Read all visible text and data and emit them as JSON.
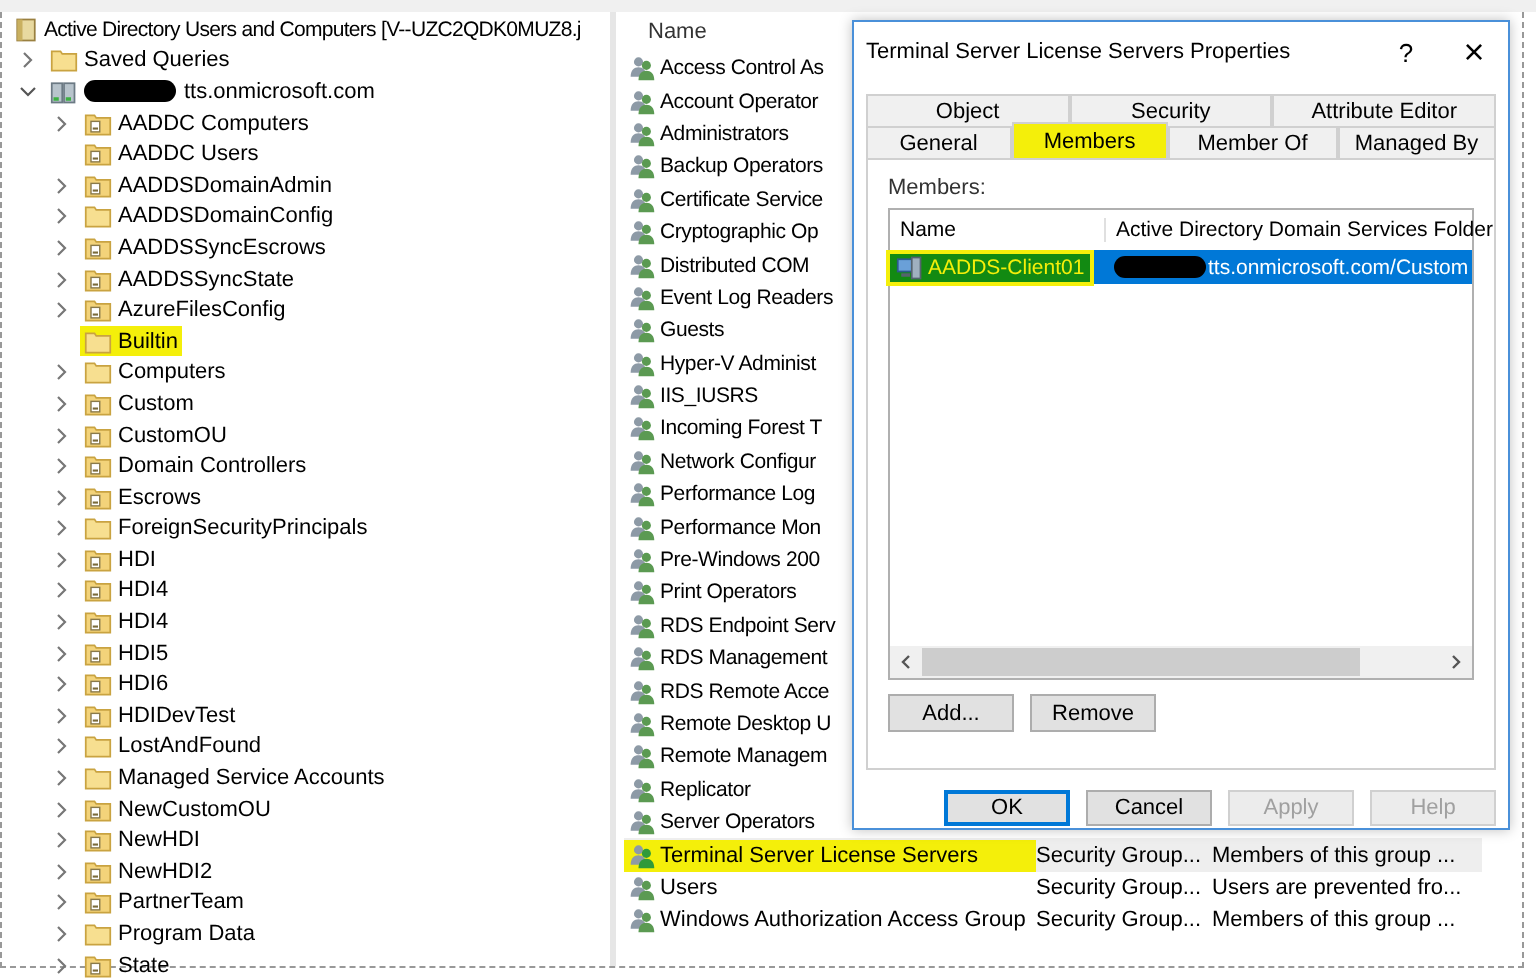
{
  "tree": {
    "root": "Active Directory Users and Computers [V--UZC2QDK0MUZ8.j",
    "items": [
      {
        "label": "Saved Queries",
        "kind": "folder",
        "has_children": true,
        "highlighted": false
      },
      {
        "label": "tts.onmicrosoft.com",
        "kind": "domain",
        "has_children": true,
        "highlighted": false,
        "children": [
          {
            "label": "AADDC Computers",
            "kind": "ou",
            "has_children": true,
            "highlighted": false
          },
          {
            "label": "AADDC Users",
            "kind": "ou",
            "has_children": false,
            "highlighted": false
          },
          {
            "label": "AADDSDomainAdmin",
            "kind": "ou",
            "has_children": true,
            "highlighted": false
          },
          {
            "label": "AADDSDomainConfig",
            "kind": "folder",
            "has_children": true,
            "highlighted": false
          },
          {
            "label": "AADDSSyncEscrows",
            "kind": "ou",
            "has_children": true,
            "highlighted": false
          },
          {
            "label": "AADDSSyncState",
            "kind": "ou",
            "has_children": true,
            "highlighted": false
          },
          {
            "label": "AzureFilesConfig",
            "kind": "ou",
            "has_children": true,
            "highlighted": false
          },
          {
            "label": "Builtin",
            "kind": "folder",
            "has_children": false,
            "highlighted": true
          },
          {
            "label": "Computers",
            "kind": "folder",
            "has_children": true,
            "highlighted": false
          },
          {
            "label": "Custom",
            "kind": "ou",
            "has_children": true,
            "highlighted": false
          },
          {
            "label": "CustomOU",
            "kind": "ou",
            "has_children": true,
            "highlighted": false
          },
          {
            "label": "Domain Controllers",
            "kind": "ou",
            "has_children": true,
            "highlighted": false
          },
          {
            "label": "Escrows",
            "kind": "ou",
            "has_children": true,
            "highlighted": false
          },
          {
            "label": "ForeignSecurityPrincipals",
            "kind": "folder",
            "has_children": true,
            "highlighted": false
          },
          {
            "label": "HDI",
            "kind": "ou",
            "has_children": true,
            "highlighted": false
          },
          {
            "label": "HDI4",
            "kind": "ou",
            "has_children": true,
            "highlighted": false
          },
          {
            "label": "HDI4",
            "kind": "ou",
            "has_children": true,
            "highlighted": false
          },
          {
            "label": "HDI5",
            "kind": "ou",
            "has_children": true,
            "highlighted": false
          },
          {
            "label": "HDI6",
            "kind": "ou",
            "has_children": true,
            "highlighted": false
          },
          {
            "label": "HDIDevTest",
            "kind": "ou",
            "has_children": true,
            "highlighted": false
          },
          {
            "label": "LostAndFound",
            "kind": "folder",
            "has_children": true,
            "highlighted": false
          },
          {
            "label": "Managed Service Accounts",
            "kind": "folder",
            "has_children": true,
            "highlighted": false
          },
          {
            "label": "NewCustomOU",
            "kind": "ou",
            "has_children": true,
            "highlighted": false
          },
          {
            "label": "NewHDI",
            "kind": "ou",
            "has_children": true,
            "highlighted": false
          },
          {
            "label": "NewHDI2",
            "kind": "ou",
            "has_children": true,
            "highlighted": false
          },
          {
            "label": "PartnerTeam",
            "kind": "ou",
            "has_children": true,
            "highlighted": false
          },
          {
            "label": "Program Data",
            "kind": "folder",
            "has_children": true,
            "highlighted": false
          },
          {
            "label": "State",
            "kind": "ou",
            "has_children": true,
            "highlighted": false
          }
        ]
      }
    ]
  },
  "list": {
    "columns": [
      "Name"
    ],
    "rows": [
      {
        "name": "Access Control As",
        "selected": false,
        "highlighted": false
      },
      {
        "name": "Account Operator",
        "selected": false,
        "highlighted": false
      },
      {
        "name": "Administrators",
        "selected": false,
        "highlighted": false
      },
      {
        "name": "Backup Operators",
        "selected": false,
        "highlighted": false
      },
      {
        "name": "Certificate Service",
        "selected": false,
        "highlighted": false
      },
      {
        "name": "Cryptographic Op",
        "selected": false,
        "highlighted": false
      },
      {
        "name": "Distributed COM",
        "selected": false,
        "highlighted": false
      },
      {
        "name": "Event Log Readers",
        "selected": false,
        "highlighted": false
      },
      {
        "name": "Guests",
        "selected": false,
        "highlighted": false
      },
      {
        "name": "Hyper-V Administ",
        "selected": false,
        "highlighted": false
      },
      {
        "name": "IIS_IUSRS",
        "selected": false,
        "highlighted": false
      },
      {
        "name": "Incoming Forest T",
        "selected": false,
        "highlighted": false
      },
      {
        "name": "Network Configur",
        "selected": false,
        "highlighted": false
      },
      {
        "name": "Performance Log",
        "selected": false,
        "highlighted": false
      },
      {
        "name": "Performance Mon",
        "selected": false,
        "highlighted": false
      },
      {
        "name": "Pre-Windows 200",
        "selected": false,
        "highlighted": false
      },
      {
        "name": "Print Operators",
        "selected": false,
        "highlighted": false
      },
      {
        "name": "RDS Endpoint Serv",
        "selected": false,
        "highlighted": false
      },
      {
        "name": "RDS Management",
        "selected": false,
        "highlighted": false
      },
      {
        "name": "RDS Remote Acce",
        "selected": false,
        "highlighted": false
      },
      {
        "name": "Remote Desktop U",
        "selected": false,
        "highlighted": false
      },
      {
        "name": "Remote Managem",
        "selected": false,
        "highlighted": false
      },
      {
        "name": "Replicator",
        "selected": false,
        "highlighted": false
      },
      {
        "name": "Server Operators",
        "selected": false,
        "highlighted": false
      },
      {
        "name": "Terminal Server License Servers",
        "type": "Security Group...",
        "description": "Members of this group ...",
        "selected": true,
        "highlighted": true
      },
      {
        "name": "Users",
        "type": "Security Group...",
        "description": "Users are prevented fro...",
        "selected": false,
        "highlighted": false
      },
      {
        "name": "Windows Authorization Access Group",
        "type": "Security Group...",
        "description": "Members of this group ...",
        "selected": false,
        "highlighted": false
      }
    ]
  },
  "dialog": {
    "title": "Terminal Server License Servers Properties",
    "help": "?",
    "close": "×",
    "tab_rows": [
      [
        {
          "label": "Object",
          "selected": false,
          "highlighted": false
        },
        {
          "label": "Security",
          "selected": false,
          "highlighted": false
        },
        {
          "label": "Attribute Editor",
          "selected": false,
          "highlighted": false
        }
      ],
      [
        {
          "label": "General",
          "selected": false,
          "highlighted": false
        },
        {
          "label": "Members",
          "selected": true,
          "highlighted": true
        },
        {
          "label": "Member Of",
          "selected": false,
          "highlighted": false
        },
        {
          "label": "Managed By",
          "selected": false,
          "highlighted": false
        }
      ]
    ],
    "members_label": "Members:",
    "columns": [
      "Name",
      "Active Directory Domain Services Folder"
    ],
    "members": [
      {
        "name": "AADDS-Client01",
        "folder": "tts.onmicrosoft.com/Custom",
        "selected": true,
        "highlighted": true
      }
    ],
    "list_buttons": [
      "Add...",
      "Remove"
    ],
    "buttons": [
      {
        "label": "OK",
        "default": true,
        "disabled": false
      },
      {
        "label": "Cancel",
        "default": false,
        "disabled": false
      },
      {
        "label": "Apply",
        "default": false,
        "disabled": true
      },
      {
        "label": "Help",
        "default": false,
        "disabled": true
      }
    ]
  }
}
